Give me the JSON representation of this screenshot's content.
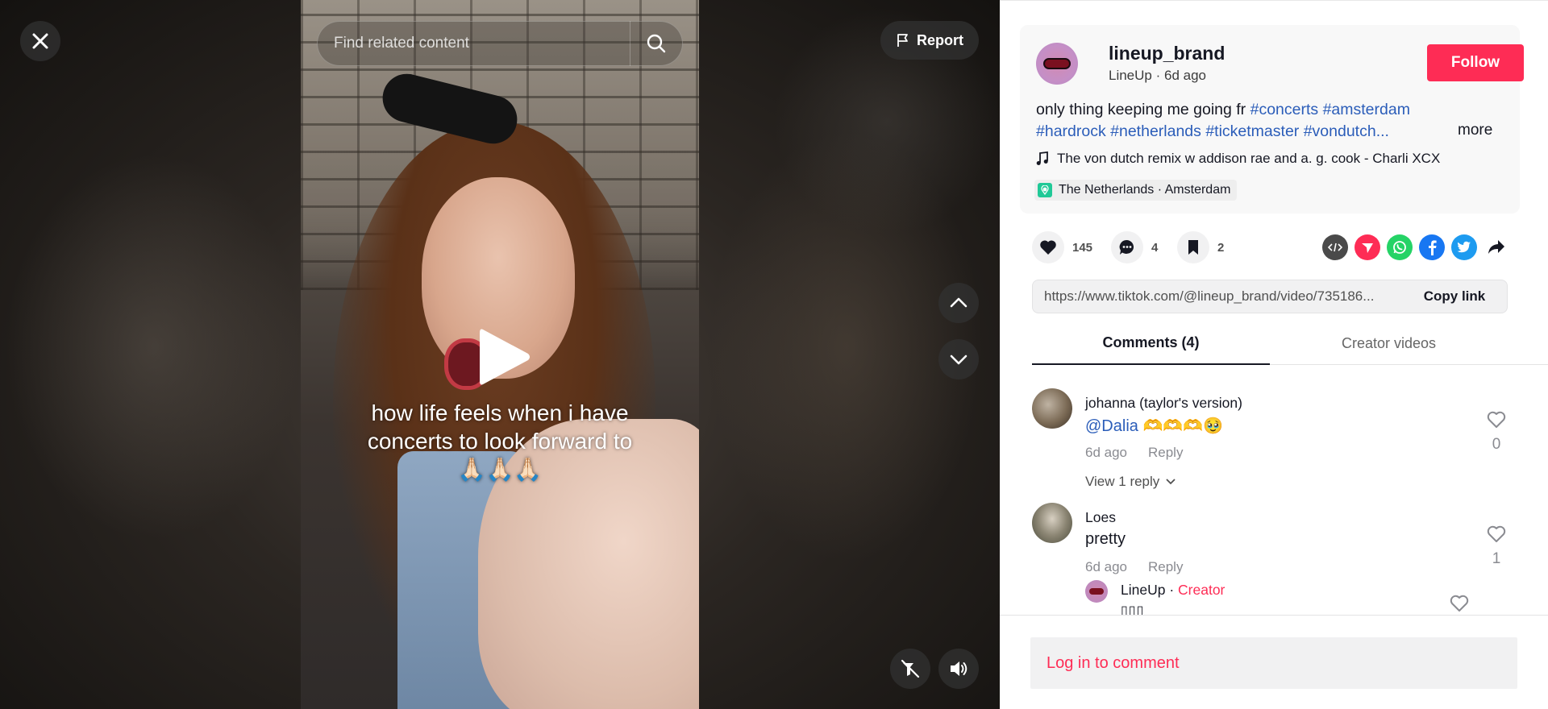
{
  "video": {
    "search_placeholder": "Find related content",
    "report_label": "Report",
    "caption_line1": "how life feels when i have",
    "caption_line2": "concerts to look forward to",
    "caption_emoji": "🙏🏻🙏🏻🙏🏻"
  },
  "post": {
    "username": "lineup_brand",
    "display_name": "LineUp",
    "age": "6d ago",
    "follow_label": "Follow",
    "description_text": "only thing keeping me going fr",
    "hashtags": [
      "#concerts",
      "#amsterdam",
      "#hardrock",
      "#netherlands",
      "#ticketmaster",
      "#vondutch..."
    ],
    "more_label": "more",
    "music": "The von dutch remix w addison rae and a. g. cook - Charli XCX",
    "location": "The Netherlands · Amsterdam"
  },
  "actions": {
    "likes": "145",
    "comments": "4",
    "saves": "2",
    "share_icons": [
      "embed-icon",
      "send-icon",
      "whatsapp-icon",
      "facebook-icon",
      "twitter-icon",
      "share-arrow-icon"
    ],
    "colors": {
      "embed": "#4a4a4a",
      "send": "#fe2c55",
      "whatsapp": "#25d366",
      "facebook": "#1877f2",
      "twitter": "#1d9bf0"
    }
  },
  "link": {
    "url": "https://www.tiktok.com/@lineup_brand/video/735186...",
    "copy_label": "Copy link"
  },
  "tabs": {
    "comments_label": "Comments (4)",
    "creator_videos_label": "Creator videos"
  },
  "comments": [
    {
      "user": "johanna (taylor's version)",
      "mention": "@Dalia",
      "text": " 🫶🫶🫶🥹",
      "age": "6d ago",
      "reply_label": "Reply",
      "likes": "0",
      "view_replies": "View 1 reply"
    },
    {
      "user": "Loes",
      "text": "pretty",
      "age": "6d ago",
      "reply_label": "Reply",
      "likes": "1",
      "reply": {
        "user": "LineUp",
        "separator": " · ",
        "badge": "Creator",
        "text": "▯▯▯"
      }
    }
  ],
  "login_label": "Log in to comment",
  "colors": {
    "accent": "#fe2c55",
    "hashtag": "#2b5db9"
  }
}
